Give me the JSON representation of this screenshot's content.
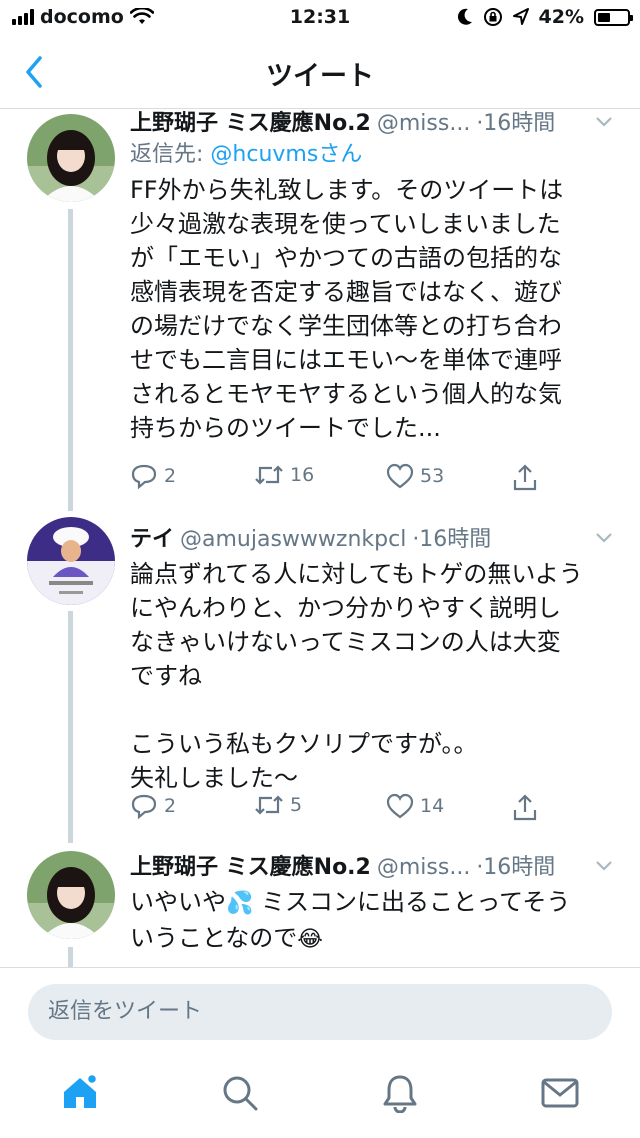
{
  "status_bar": {
    "carrier": "docomo",
    "time": "12:31",
    "battery": "42%",
    "battery_level": 0.42
  },
  "nav": {
    "title": "ツイート"
  },
  "tweets": [
    {
      "name": "上野瑚子 ミス慶應No.2",
      "handle": "@miss...",
      "time": "·16時間",
      "reply_prefix": "返信先:",
      "reply_to": "@hcuvmsさん",
      "body": "FF外から失礼致します。そのツイートは\n少々過激な表現を使っていしまいました\nが「エモい」やかつての古語の包括的な\n感情表現を否定する趣旨ではなく、遊び\nの場だけでなく学生団体等との打ち合わ\nせでも二言目にはエモい〜を単体で連呼\nされるとモヤモヤするという個人的な気\n持ちからのツイートでした...",
      "replies": "2",
      "retweets": "16",
      "likes": "53"
    },
    {
      "name": "テイ",
      "handle": "@amujaswwwznkpcl",
      "time": "·16時間",
      "body": "論点ずれてる人に対してもトゲの無いよう\nにやんわりと、かつ分かりやすく説明し\nなきゃいけないってミスコンの人は大変\nですね\n\nこういう私もクソリプですが。。\n失礼しました〜",
      "replies": "2",
      "retweets": "5",
      "likes": "14"
    },
    {
      "name": "上野瑚子 ミス慶應No.2",
      "handle": "@miss...",
      "time": "·16時間",
      "body_a": "いやいや",
      "emoji_a": "💦",
      "body_b": " ミスコンに出ることってそう\nいうことなので",
      "emoji_b": "😂"
    }
  ],
  "composer": {
    "placeholder": "返信をツイート"
  },
  "tabs": [
    "home-icon",
    "search-icon",
    "notifications-icon",
    "messages-icon"
  ],
  "colors": {
    "accent": "#1da1f2",
    "muted": "#657786",
    "thread_line": "#ccd6dd"
  }
}
